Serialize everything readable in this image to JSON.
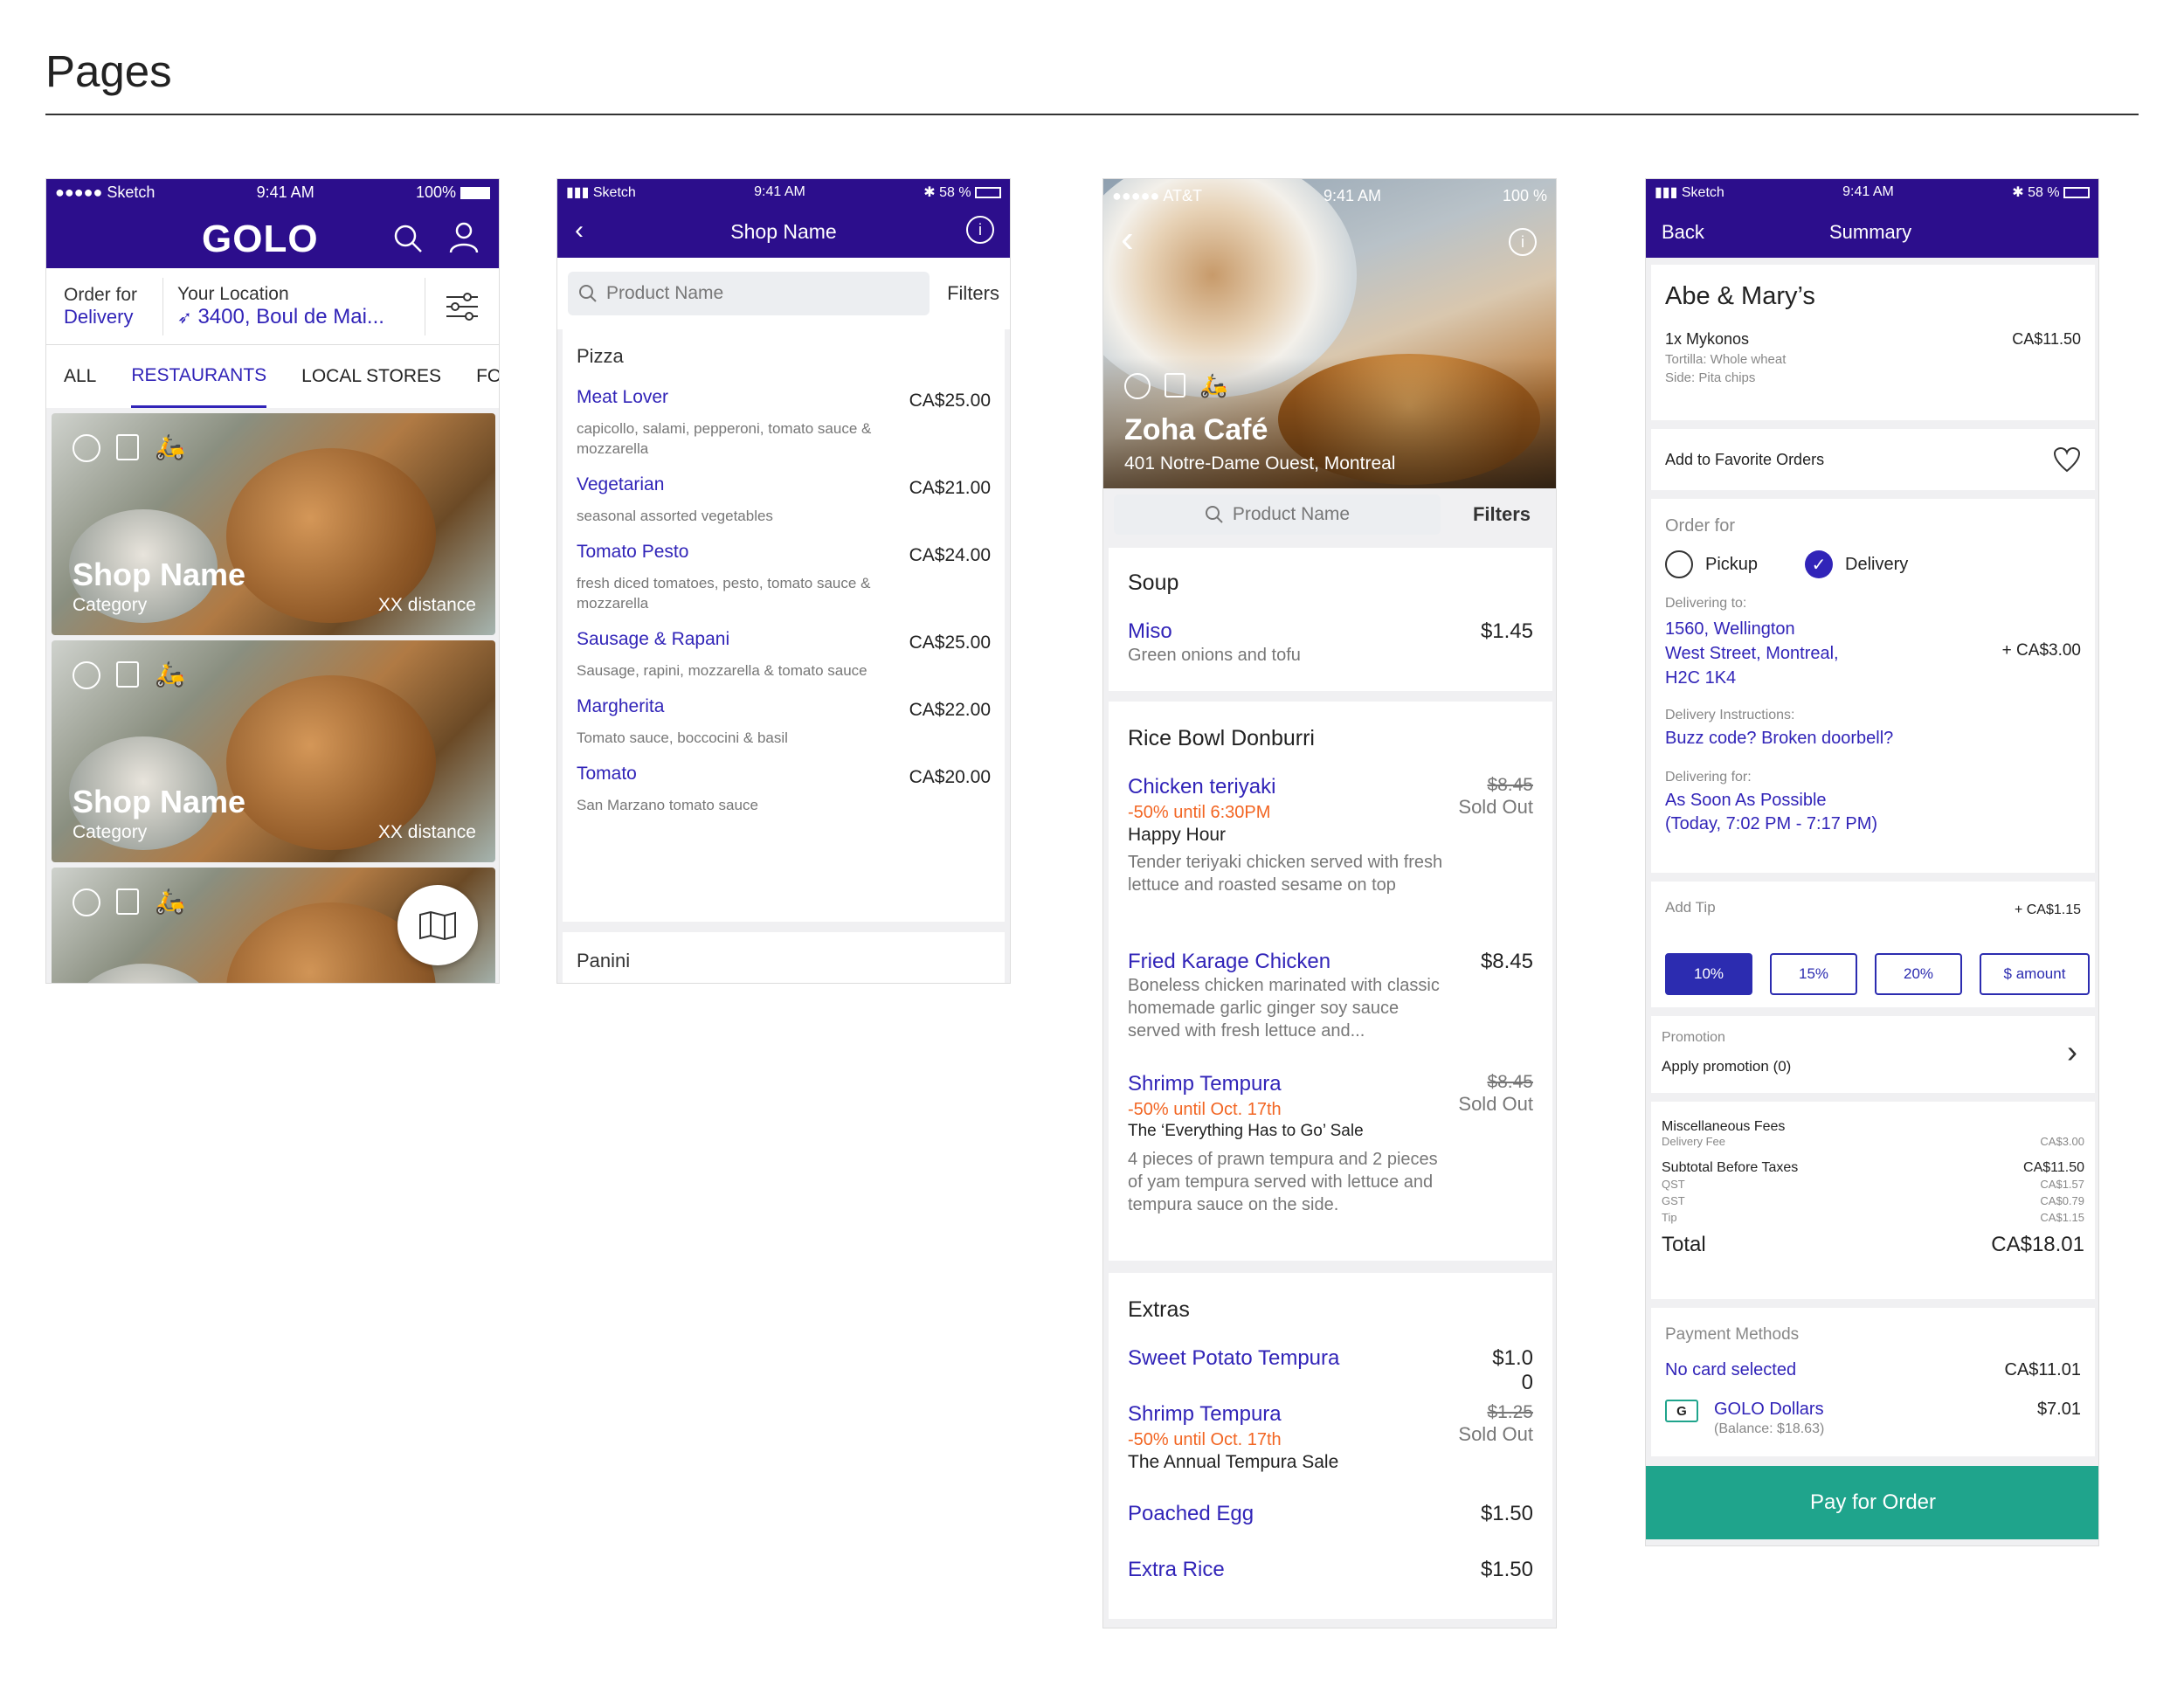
{
  "page": {
    "title": "Pages"
  },
  "status_p1": {
    "carrier": "●●●●● Sketch",
    "time": "9:41 AM",
    "battery": "100%"
  },
  "status_p2": {
    "carrier": "Sketch",
    "time": "9:41 AM",
    "battery": "58 %"
  },
  "status_p3": {
    "carrier": "●●●●● AT&T",
    "time": "9:41 AM",
    "battery": "100 %"
  },
  "status_p4": {
    "carrier": "Sketch",
    "time": "9:41 AM",
    "battery": "58 %"
  },
  "home": {
    "logo": "GOLO",
    "order_for_label": "Order for",
    "order_for_value": "Delivery",
    "location_label": "Your Location",
    "location_value": "3400, Boul de Mai...",
    "tabs": [
      "ALL",
      "RESTAURANTS",
      "LOCAL STORES",
      "FOOD"
    ],
    "active_tab": "RESTAURANTS",
    "cards": [
      {
        "name": "Shop Name",
        "category": "Category",
        "distance": "XX distance"
      },
      {
        "name": "Shop Name",
        "category": "Category",
        "distance": "XX distance"
      }
    ]
  },
  "shop": {
    "title": "Shop Name",
    "search_placeholder": "Product Name",
    "filters": "Filters",
    "category": "Pizza",
    "items": [
      {
        "name": "Meat Lover",
        "price": "CA$25.00",
        "desc": "capicollo, salami, pepperoni, tomato sauce & mozzarella"
      },
      {
        "name": "Vegetarian",
        "price": "CA$21.00",
        "desc": "seasonal assorted vegetables"
      },
      {
        "name": "Tomato Pesto",
        "price": "CA$24.00",
        "desc": "fresh diced tomatoes, pesto, tomato sauce & mozzarella"
      },
      {
        "name": "Sausage & Rapani",
        "price": "CA$25.00",
        "desc": "Sausage, rapini, mozzarella & tomato sauce"
      },
      {
        "name": "Margherita",
        "price": "CA$22.00",
        "desc": "Tomato sauce, boccocini & basil"
      },
      {
        "name": "Tomato",
        "price": "CA$20.00",
        "desc": "San Marzano tomato sauce"
      }
    ],
    "next_category": "Panini"
  },
  "cafe": {
    "name": "Zoha Café",
    "address": "401 Notre-Dame Ouest, Montreal",
    "search_placeholder": "Product Name",
    "filters": "Filters",
    "soup": {
      "title": "Soup",
      "item": "Miso",
      "price": "$1.45",
      "desc": "Green onions and tofu"
    },
    "rice": {
      "title": "Rice Bowl Donburri",
      "i1_name": "Chicken teriyaki",
      "i1_promo": "-50% until 6:30PM",
      "i1_sale": "Happy Hour",
      "i1_old": "$8.45",
      "i1_sold": "Sold Out",
      "i1_desc": "Tender teriyaki chicken served with fresh lettuce and roasted sesame on top",
      "i2_name": "Fried Karage Chicken",
      "i2_price": "$8.45",
      "i2_desc": "Boneless chicken marinated with classic homemade garlic ginger soy sauce served with fresh lettuce and...",
      "i3_name": "Shrimp Tempura",
      "i3_promo": "-50% until Oct. 17th",
      "i3_sale": "The ‘Everything Has to Go’ Sale",
      "i3_old": "$8.45",
      "i3_sold": "Sold Out",
      "i3_desc": "4 pieces of prawn tempura and 2 pieces of yam tempura served with lettuce and tempura sauce on the side."
    },
    "extras": {
      "title": "Extras",
      "e1_name": "Sweet Potato Tempura",
      "e1_price_a": "$1.0",
      "e1_price_b": "0",
      "e2_name": "Shrimp Tempura",
      "e2_old": "$1.25",
      "e2_promo": "-50% until Oct. 17th",
      "e2_sold": "Sold Out",
      "e2_sale": "The Annual Tempura Sale",
      "e3_name": "Poached Egg",
      "e3_price": "$1.50",
      "e4_name": "Extra Rice",
      "e4_price": "$1.50"
    }
  },
  "summary": {
    "back": "Back",
    "title": "Summary",
    "restaurant": "Abe & Mary’s",
    "item": "1x Mykonos",
    "item_price": "CA$11.50",
    "item_opt1": "Tortilla: Whole wheat",
    "item_opt2": "Side: Pita chips",
    "favorite": "Add to Favorite Orders",
    "order_for": "Order for",
    "pickup": "Pickup",
    "delivery": "Delivery",
    "delivering_to_label": "Delivering to:",
    "address_l1": "1560, Wellington",
    "address_l2": "West Street, Montreal,",
    "address_l3": "H2C 1K4",
    "delivery_fee": "+ CA$3.00",
    "instructions_label": "Delivery Instructions:",
    "instructions_value": "Buzz code? Broken doorbell?",
    "delivering_for_label": "Delivering for:",
    "delivering_for_l1": "As Soon As Possible",
    "delivering_for_l2": "(Today, 7:02 PM - 7:17 PM)",
    "tip_label": "Add Tip",
    "tip_value": "+ CA$1.15",
    "tips": [
      "10%",
      "15%",
      "20%",
      "$ amount"
    ],
    "promo_label": "Promotion",
    "promo_value": "Apply promotion (0)",
    "misc_label": "Miscellaneous Fees",
    "delivery_fee_label": "Delivery Fee",
    "delivery_fee_value": "CA$3.00",
    "subtotal_label": "Subtotal Before Taxes",
    "subtotal_value": "CA$11.50",
    "qst_label": "QST",
    "qst_value": "CA$1.57",
    "gst_label": "GST",
    "gst_value": "CA$0.79",
    "tip_line_label": "Tip",
    "tip_line_value": "CA$1.15",
    "total_label": "Total",
    "total_value": "CA$18.01",
    "payment_label": "Payment Methods",
    "no_card": "No card selected",
    "no_card_amount": "CA$11.01",
    "golo_dollars": "GOLO Dollars",
    "golo_amount": "$7.01",
    "golo_balance": "(Balance: $18.63)",
    "pay_button": "Pay for Order"
  },
  "colors": {
    "brand_purple": "#2c0e8c",
    "link_blue": "#3124b8",
    "promo_orange": "#f26522",
    "pay_green": "#1fa48c"
  }
}
